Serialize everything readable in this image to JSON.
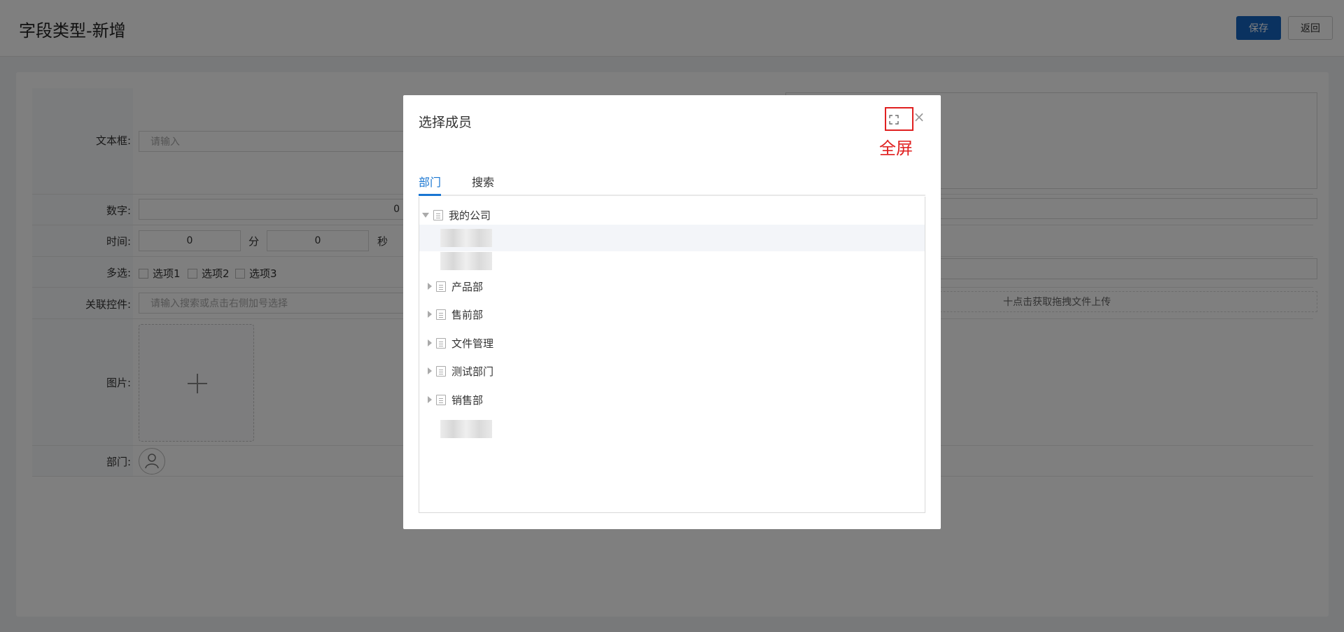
{
  "page": {
    "title": "字段类型-新增",
    "save_label": "保存",
    "back_label": "返回"
  },
  "form": {
    "textbox_label": "文本框:",
    "textbox_placeholder": "请输入",
    "number_label": "数字:",
    "number_value": "0",
    "time_label": "时间:",
    "time_minutes": "0",
    "minutes_unit": "分",
    "time_seconds": "0",
    "seconds_unit": "秒",
    "multi_label": "多选:",
    "options": [
      "选项1",
      "选项2",
      "选项3"
    ],
    "relation_label": "关联控件:",
    "relation_placeholder": "请输入搜索或点击右侧加号选择",
    "upload_text": "点击获取拖拽文件上传",
    "image_label": "图片:",
    "dept_label": "部门:"
  },
  "modal": {
    "title": "选择成员",
    "fullscreen_annotation": "全屏",
    "tabs": [
      {
        "label": "部门",
        "active": true
      },
      {
        "label": "搜索",
        "active": false
      }
    ],
    "tree": {
      "root": "我的公司",
      "children": [
        "产品部",
        "售前部",
        "文件管理",
        "测试部门",
        "销售部"
      ]
    }
  },
  "colors": {
    "primary": "#1565c0",
    "tab_active": "#1976d2",
    "annotation": "#e02020"
  }
}
